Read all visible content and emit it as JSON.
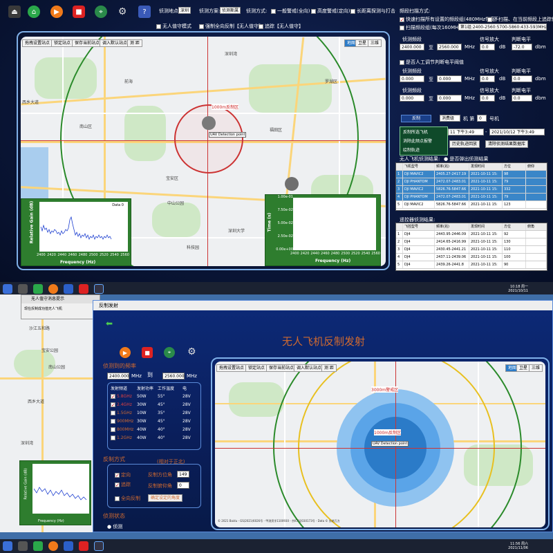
{
  "toolbar": {
    "location_label": "侦测地点:",
    "location_value": "深圳",
    "scheme_label": "侦测方案:",
    "scheme_value": "侦测斯属",
    "method_label": "侦测方式:",
    "opt_general": "一般警戒(全向)",
    "opt_high": "高度警戒(定向)",
    "opt_long": "长距离探测与打击",
    "opt_uav_mode": "无人值守模式",
    "opt_force": "强制全向反制【无人值守】",
    "opt_track": "追踪【无人值守】",
    "freq_scan_label": "频段扫描方式:",
    "scan_all": "快速扫描所有设置的频段组(480MHz带宽)",
    "scan_single": "扫描频段组(每次160MHz带宽)",
    "scan_group": "第1组:2400-2560:5700-5860:433-593MHz",
    "no_scan": "不扫描、在当前频段上追踪侦测"
  },
  "map1": {
    "buttons": [
      "拖拽设置站点",
      "锁定站点",
      "保存当前站点",
      "调入默认站点",
      "测 距"
    ],
    "view_buttons": [
      "地图",
      "卫星",
      "三维"
    ],
    "range_label": "1000m反制区",
    "detection_label": "UAV Detection point",
    "places": [
      "西乡大道",
      "深圳湾",
      "南山区",
      "宝安区",
      "福田区",
      "罗湖区",
      "中山公园",
      "深圳大学",
      "科技园",
      "前海"
    ]
  },
  "spectrum_plot": {
    "legend": "Data 0",
    "ylabel": "Relative Gain (dB)",
    "xlabel": "Frequency (Hz)",
    "xticks": [
      "2400",
      "2420",
      "2440",
      "2460",
      "2480",
      "2500",
      "2520",
      "2540",
      "2560"
    ]
  },
  "time_plot": {
    "ylabel": "Time (s)",
    "xlabel": "Frequency (Hz)",
    "yticks": [
      "0.00e+00",
      "2.50e-02",
      "5.00e-02",
      "7.50e-02",
      "1.00e-01"
    ],
    "xticks": [
      "2400",
      "2420",
      "2440",
      "2460",
      "2480",
      "2500",
      "2520",
      "2540",
      "2560"
    ]
  },
  "right_panel": {
    "detect_band": "侦测频段",
    "gain": "信号放大",
    "level": "判断电平",
    "to": "至",
    "mhz": "MHz",
    "db": "dB",
    "dbm": "dbm",
    "band1_from": "2400.000",
    "band1_to": "2560.000",
    "band1_gain": "0.0",
    "band1_level": "-72.0",
    "band2_from": "0.000",
    "band2_to": "0.000",
    "band2_gain": "0.0",
    "band2_level": "0.0",
    "band3_from": "0.000",
    "band3_to": "0.000",
    "band3_gain": "0.0",
    "band3_level": "0.0",
    "manual_check": "是否人工调节判断电平阈值",
    "counter_btn": "反制",
    "mode_value": "消费级",
    "machine": "机 第",
    "machine_num": "0",
    "machine_suffix": "号机",
    "menu": [
      "反制所选飞机",
      "消除此频点报警",
      "绘制轨迹"
    ],
    "time_from": "11 下午3:49",
    "time_to": "2021/10/12 下午3:49",
    "history_btn": "历史轨迹回放",
    "clear_btn": "清除侦测结果数据库",
    "result_label": "无人飞机侦测结果:",
    "result_radio": "是否弹出侦测结果",
    "remote_label": "遥控器侦测结果:"
  },
  "uav_table": {
    "headers": [
      "",
      "飞机型号",
      "频率(兆)",
      "发现时间",
      "方位",
      "俯仰"
    ],
    "rows": [
      [
        "1",
        "DJI MAVIC2",
        "2405.27-2417.19",
        "2021-10-11 15:",
        "98",
        ""
      ],
      [
        "2",
        "DJI PHANTOM",
        "2472.07-2483.01",
        "2021-10-11 15:",
        "79",
        ""
      ],
      [
        "3",
        "DJI MAVIC2",
        "5826.76-5847.66",
        "2021-10-11 15:",
        "332",
        ""
      ],
      [
        "4",
        "DJI PHANTOM",
        "2472.07-2483.01",
        "2021-10-11 15:",
        "79",
        ""
      ],
      [
        "5",
        "DJI MAVIC2",
        "5826.76-5847.66",
        "2021-10-11 15:",
        "123",
        ""
      ]
    ]
  },
  "remote_table": {
    "headers": [
      "",
      "飞控型号",
      "频率(兆)",
      "发现时间",
      "方位",
      "俯角"
    ],
    "rows": [
      [
        "1",
        "DJ4",
        "2443.95-2446.09",
        "2021-10-11 15:",
        "92",
        ""
      ],
      [
        "2",
        "DJ4",
        "2414.65-2416.99",
        "2021-10-11 15:",
        "130",
        ""
      ],
      [
        "3",
        "DJ4",
        "2430.45-2441.21",
        "2021-10-11 15:",
        "110",
        ""
      ],
      [
        "4",
        "DJ4",
        "2437.11-2439.06",
        "2021-10-11 15:",
        "100",
        ""
      ],
      [
        "5",
        "DJ4",
        "2439.26-2441.8",
        "2021-10-11 15:",
        "90",
        ""
      ]
    ]
  },
  "taskbar1": {
    "time": "10:18 周一",
    "date": "2021/10/11"
  },
  "taskbar2": {
    "time": "11:56 周六",
    "date": "2021/11/06"
  },
  "app2": {
    "msg_title": "无人值守消息提示",
    "msg_body": "现在反制成功值无人飞机",
    "window_title": "反制发射",
    "main_title": "无人飞机反制发射",
    "freq_label": "侦测到的频率",
    "freq_from": "2400.000",
    "freq_to": "2560.000",
    "to": "到",
    "mhz": "MHz",
    "tx_headers": [
      "发射频道",
      "发射功率",
      "工作温度",
      "电"
    ],
    "tx_rows": [
      {
        "band": "5.8GHz",
        "power": "50W",
        "temp": "55°",
        "v": "28V",
        "checked": true
      },
      {
        "band": "2.4GHz",
        "power": "30W",
        "temp": "45°",
        "v": "28V",
        "checked": true
      },
      {
        "band": "1.5GHz",
        "power": "10W",
        "temp": "35°",
        "v": "28V",
        "checked": false
      },
      {
        "band": "900MHz",
        "power": "30W",
        "temp": "45°",
        "v": "28V",
        "checked": false
      },
      {
        "band": "800MHz",
        "power": "40W",
        "temp": "40°",
        "v": "28V",
        "checked": false
      },
      {
        "band": "1.2GHz",
        "power": "40W",
        "temp": "40°",
        "v": "28V",
        "checked": false
      }
    ],
    "counter_mode": "反制方式",
    "relative_north": "(相对于正北)",
    "opt_directed": "定向",
    "opt_track": "追踪",
    "opt_omni": "全向反制",
    "azimuth_label": "反制方位角",
    "azimuth_value": "149",
    "pitch_label": "反制俯仰角",
    "pitch_value": "0",
    "confirm_btn": "确定设定的角度",
    "status_label": "侦测状态",
    "status_value": "侦测",
    "range_3000": "3000m警戒区",
    "range_1000": "1000m反制区",
    "detection_label": "UAV Detection point",
    "copyright": "© 2021 Baidu - GS(2021)6026号 - 甲测资字1100930 - 京ICP证030173号 - Data © 长地万方",
    "side_places": [
      "沙江五和路",
      "宝安公园",
      "南山公园",
      "西乡大道",
      "深圳湾"
    ]
  },
  "colors": {
    "accent": "#2b7bc8",
    "plot_bg": "#2e7d2e",
    "highlight": "#3a86c8"
  }
}
